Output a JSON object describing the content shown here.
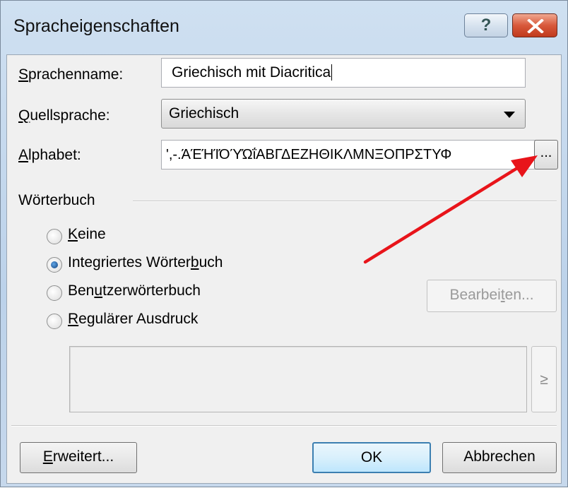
{
  "window": {
    "title": "Spracheigenschaften",
    "help_glyph": "?"
  },
  "form": {
    "sprachenname": {
      "prefix": "S",
      "rest": "prachenname:",
      "value": "Griechisch mit Diacritica"
    },
    "quellsprache": {
      "prefix": "Q",
      "rest": "uellsprache:",
      "value": "Griechisch"
    },
    "alphabet": {
      "prefix": "A",
      "rest": "lphabet:",
      "value": "',-.ΆΈΉΊΌΎΏΐΑΒΓΔΕΖΗΘΙΚΛΜΝΞΟΠΡΣΤΥΦ",
      "browse_label": "..."
    }
  },
  "dictionary": {
    "group_label": "Wörterbuch",
    "options": [
      {
        "pre": "",
        "u": "K",
        "post": "eine",
        "selected": false
      },
      {
        "pre": "Integriertes Wörter",
        "u": "b",
        "post": "uch",
        "selected": true
      },
      {
        "pre": "Ben",
        "u": "u",
        "post": "tzerwörterbuch",
        "selected": false
      },
      {
        "pre": "",
        "u": "R",
        "post": "egulärer Ausdruck",
        "selected": false
      }
    ],
    "edit_button": {
      "pre": "Bearbei",
      "u": "t",
      "post": "en..."
    },
    "expr_button": "≥"
  },
  "footer": {
    "advanced": {
      "u": "E",
      "post": "rweitert..."
    },
    "ok": "OK",
    "cancel": "Abbrechen"
  },
  "colors": {
    "annotation_arrow": "#e8141a"
  }
}
